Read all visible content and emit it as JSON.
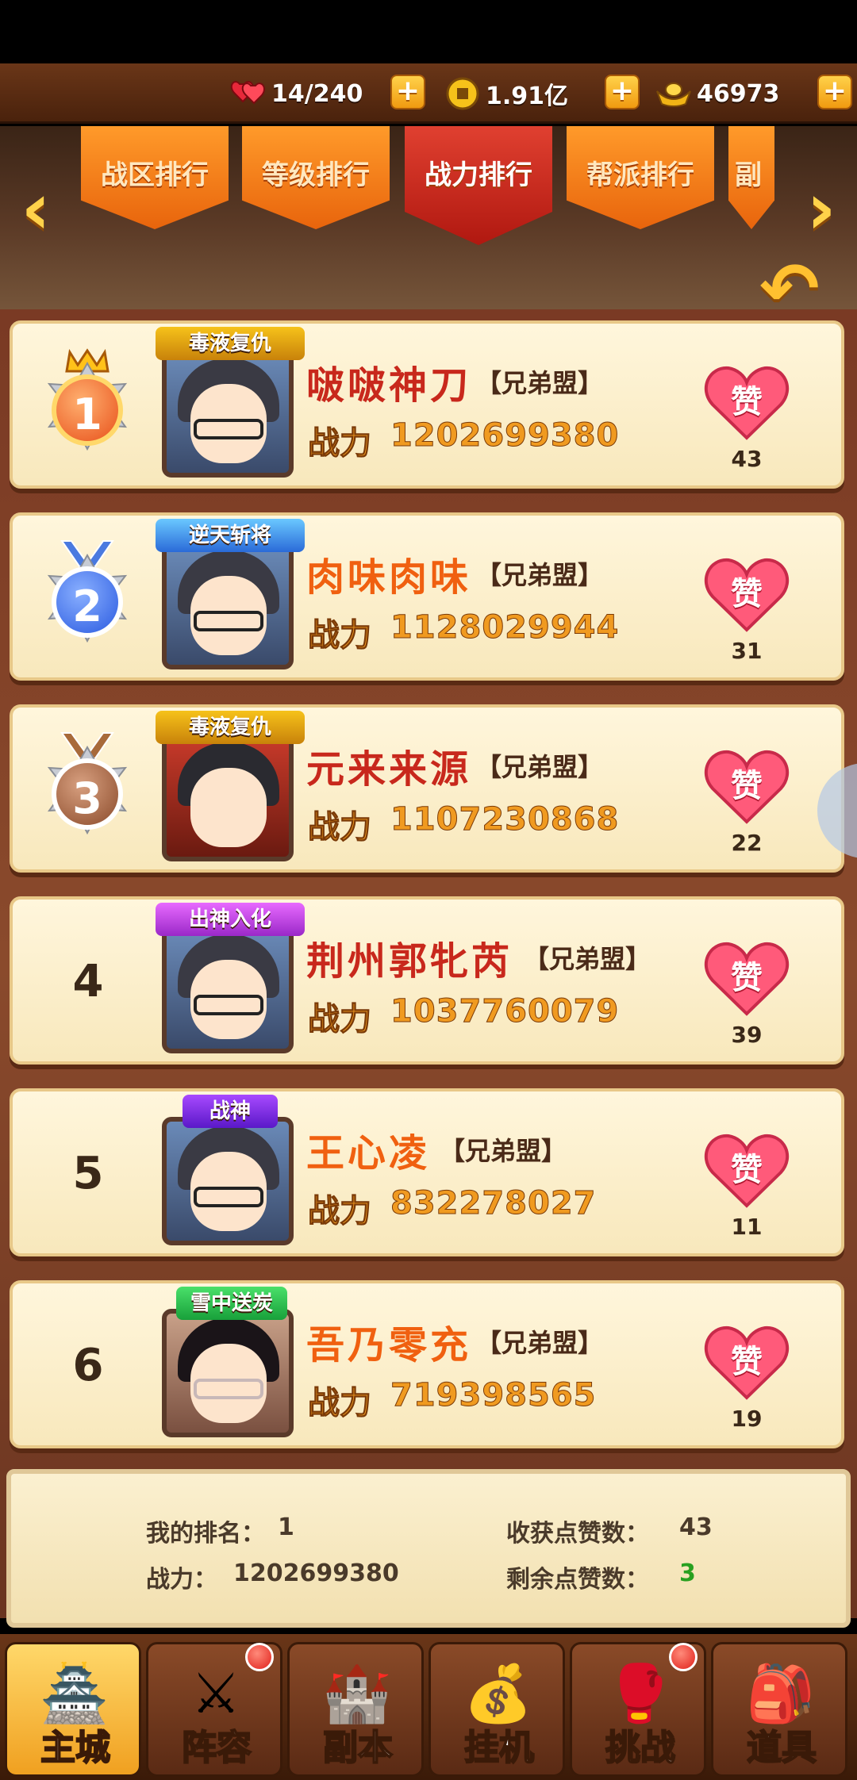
{
  "resources": {
    "stamina": {
      "icon": "heart-pair-icon",
      "value": "14/240"
    },
    "coins": {
      "icon": "coin-icon",
      "value": "1.91亿"
    },
    "ingots": {
      "icon": "gold-ingot-icon",
      "value": "46973"
    }
  },
  "tabs": [
    {
      "label": "战区排行",
      "active": false
    },
    {
      "label": "等级排行",
      "active": false
    },
    {
      "label": "战力排行",
      "active": true
    },
    {
      "label": "帮派排行",
      "active": false
    },
    {
      "label": "副",
      "active": false
    }
  ],
  "rankings": [
    {
      "rank": "1",
      "badge": "毒液复仇",
      "name": "啵啵神刀",
      "guild": "【兄弟盟】",
      "power_label": "战力",
      "power": "1202699380",
      "like_label": "赞",
      "likes": "43"
    },
    {
      "rank": "2",
      "badge": "逆天斩将",
      "name": "肉味肉味",
      "guild": "【兄弟盟】",
      "power_label": "战力",
      "power": "1128029944",
      "like_label": "赞",
      "likes": "31"
    },
    {
      "rank": "3",
      "badge": "毒液复仇",
      "name": "元来来源",
      "guild": "【兄弟盟】",
      "power_label": "战力",
      "power": "1107230868",
      "like_label": "赞",
      "likes": "22"
    },
    {
      "rank": "4",
      "badge": "出神入化",
      "name": "荆州郭牝芮",
      "guild": "【兄弟盟】",
      "power_label": "战力",
      "power": "1037760079",
      "like_label": "赞",
      "likes": "39"
    },
    {
      "rank": "5",
      "badge": "战神",
      "name": "王心凌",
      "guild": "【兄弟盟】",
      "power_label": "战力",
      "power": "832278027",
      "like_label": "赞",
      "likes": "11"
    },
    {
      "rank": "6",
      "badge": "雪中送炭",
      "name": "吾乃零充",
      "guild": "【兄弟盟】",
      "power_label": "战力",
      "power": "719398565",
      "like_label": "赞",
      "likes": "19"
    }
  ],
  "my_info": {
    "rank_label": "我的排名：",
    "rank_value": "1",
    "power_label": "战力：",
    "power_value": "1202699380",
    "received_label": "收获点赞数：",
    "received_value": "43",
    "remaining_label": "剩余点赞数：",
    "remaining_value": "3"
  },
  "bottom_nav": [
    {
      "label": "主城",
      "icon": "castle-icon",
      "active": true,
      "badge": false
    },
    {
      "label": "阵容",
      "icon": "formation-icon",
      "active": false,
      "badge": true
    },
    {
      "label": "副本",
      "icon": "dungeon-icon",
      "active": false,
      "badge": false
    },
    {
      "label": "挂机",
      "icon": "idle-bag-icon",
      "active": false,
      "badge": false
    },
    {
      "label": "挑战",
      "icon": "challenge-icon",
      "active": false,
      "badge": true
    },
    {
      "label": "道具",
      "icon": "items-bag-icon",
      "active": false,
      "badge": false
    }
  ]
}
